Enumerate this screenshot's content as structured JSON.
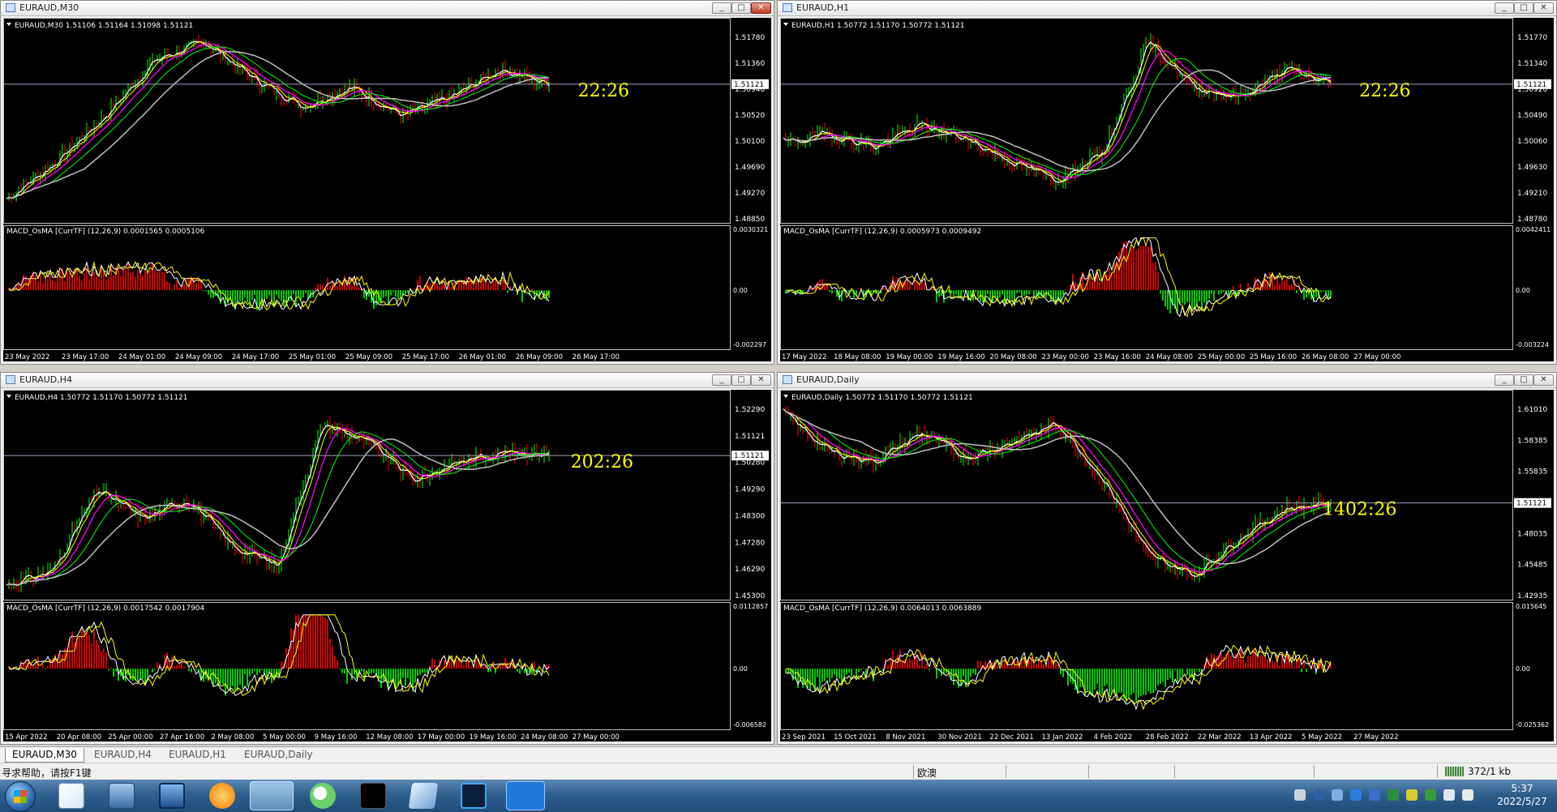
{
  "windows": [
    {
      "id": "m30",
      "title": "EURAUD,M30",
      "info": "EURAUD,M30  1.51106 1.51164 1.51098 1.51121",
      "price_labels": [
        "1.51780",
        "1.51360",
        "1.50940",
        "1.50520",
        "1.50100",
        "1.49690",
        "1.49270",
        "1.48850"
      ],
      "current_price": "1.51121",
      "timer": "22:26",
      "macd_info": "MACD_OsMA [CurrTF] (12,26,9) 0.0001565 0.0005106",
      "macd_labels": [
        "0.0030321",
        "0.00",
        "-0.002297"
      ],
      "time_labels": [
        "23 May 2022",
        "23 May 17:00",
        "24 May 01:00",
        "24 May 09:00",
        "24 May 17:00",
        "25 May 01:00",
        "25 May 09:00",
        "25 May 17:00",
        "26 May 01:00",
        "26 May 09:00",
        "26 May 17:00"
      ]
    },
    {
      "id": "h1",
      "title": "EURAUD,H1",
      "info": "EURAUD,H1  1.50772 1.51170 1.50772 1.51121",
      "price_labels": [
        "1.51770",
        "1.51340",
        "1.50920",
        "1.50490",
        "1.50060",
        "1.49630",
        "1.49210",
        "1.48780"
      ],
      "current_price": "1.51121",
      "timer": "22:26",
      "macd_info": "MACD_OsMA [CurrTF] (12,26,9) 0.0005973 0.0009492",
      "macd_labels": [
        "0.0042411",
        "0.00",
        "-0.003224"
      ],
      "time_labels": [
        "17 May 2022",
        "18 May 08:00",
        "19 May 00:00",
        "19 May 16:00",
        "20 May 08:00",
        "23 May 00:00",
        "23 May 16:00",
        "24 May 08:00",
        "25 May 00:00",
        "25 May 16:00",
        "26 May 08:00",
        "27 May 00:00"
      ]
    },
    {
      "id": "h4",
      "title": "EURAUD,H4",
      "info": "EURAUD,H4  1.50772 1.51170 1.50772 1.51121",
      "price_labels": [
        "1.52290",
        "1.51121",
        "1.50280",
        "1.49290",
        "1.48300",
        "1.47280",
        "1.46290",
        "1.45300"
      ],
      "current_price": "1.51121",
      "timer": "202:26",
      "macd_info": "MACD_OsMA [CurrTF] (12,26,9) 0.0017542 0.0017904",
      "macd_labels": [
        "0.0112857",
        "0.00",
        "-0.006582"
      ],
      "time_labels": [
        "15 Apr 2022",
        "20 Apr 08:00",
        "25 Apr 00:00",
        "27 Apr 16:00",
        "2 May 08:00",
        "5 May 00:00",
        "9 May 16:00",
        "12 May 08:00",
        "17 May 00:00",
        "19 May 16:00",
        "24 May 08:00",
        "27 May 00:00"
      ]
    },
    {
      "id": "daily",
      "title": "EURAUD,Daily",
      "info": "EURAUD,Daily  1.50772 1.51170 1.50772 1.51121",
      "price_labels": [
        "1.61010",
        "1.58385",
        "1.55835",
        "1.53080",
        "1.48035",
        "1.45485",
        "1.42935"
      ],
      "current_price": "1.51121",
      "timer": "1402:26",
      "macd_info": "MACD_OsMA [CurrTF] (12,26,9) 0.0064013 0.0063889",
      "macd_labels": [
        "0.015645",
        "0.00",
        "-0.025362"
      ],
      "time_labels": [
        "23 Sep 2021",
        "15 Oct 2021",
        "8 Nov 2021",
        "30 Nov 2021",
        "22 Dec 2021",
        "13 Jan 2022",
        "4 Feb 2022",
        "28 Feb 2022",
        "22 Mar 2022",
        "13 Apr 2022",
        "5 May 2022",
        "27 May 2022"
      ]
    }
  ],
  "tabs": [
    "EURAUD,M30",
    "EURAUD,H4",
    "EURAUD,H1",
    "EURAUD,Daily"
  ],
  "status": {
    "help": "寻求帮助，请按F1键",
    "profile": "欧澳",
    "connection": "372/1 kb"
  },
  "clock": {
    "time": "5:37",
    "date": "2022/5/27"
  },
  "colors": {
    "bull": "#00ff00",
    "bear": "#ff0000",
    "timer": "#ffff00",
    "ma_fast": "#ffffff",
    "ma_yellow": "#ffff00",
    "ma_magenta": "#ff00ff",
    "ma_green": "#00ff00",
    "ma_grey": "#c0c0c0",
    "macd_pos": "#ff0000",
    "macd_neg": "#00ff00"
  }
}
